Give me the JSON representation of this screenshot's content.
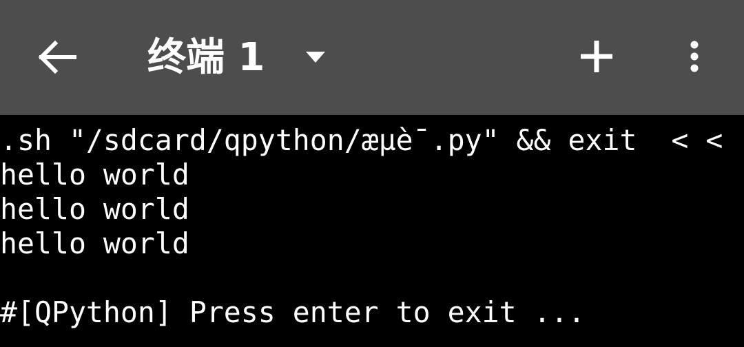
{
  "toolbar": {
    "back_icon": "arrow-left-icon",
    "title": "终端 1",
    "dropdown_icon": "triangle-down-icon",
    "add_icon": "plus-icon",
    "more_icon": "more-vertical-icon"
  },
  "terminal": {
    "lines": [
      ".sh \"/sdcard/qpython/æµè¯.py\" && exit  < <",
      "hello world",
      "hello world",
      "hello world",
      "",
      "#[QPython] Press enter to exit ..."
    ]
  },
  "colors": {
    "toolbar_bg": "#4d4d4d",
    "terminal_bg": "#000000",
    "text": "#ffffff"
  }
}
